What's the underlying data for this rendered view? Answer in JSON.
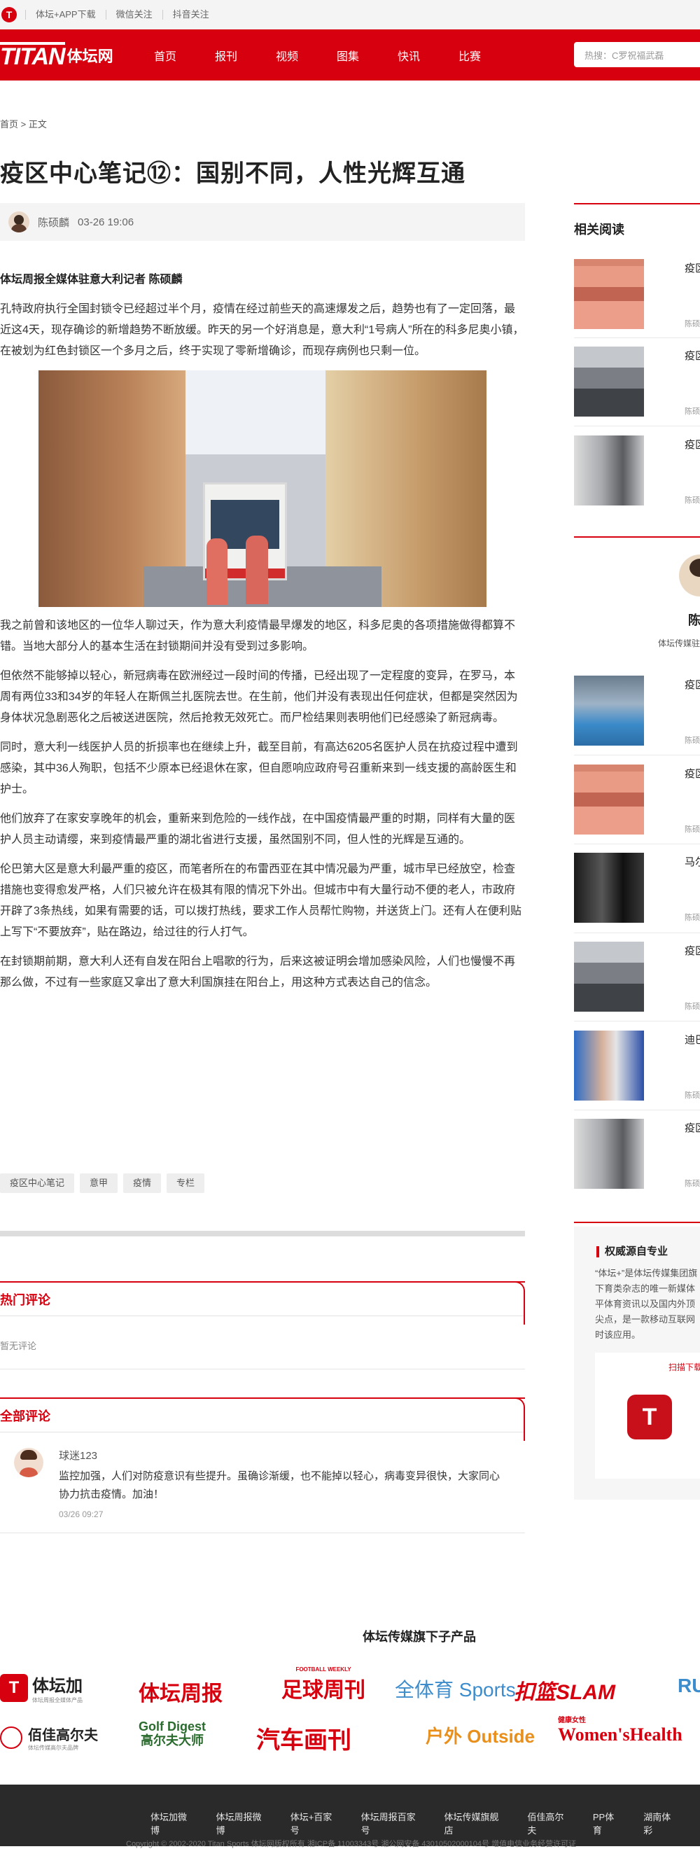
{
  "topbar": {
    "items": [
      "体坛+APP下载",
      "微信关注",
      "抖音关注"
    ]
  },
  "nav": {
    "brand_en": "TITAN",
    "brand_cn": "体坛网",
    "items": [
      "首页",
      "报刊",
      "视频",
      "图集",
      "快讯",
      "比赛"
    ],
    "search_placeholder": "热搜：C罗祝福武磊"
  },
  "breadcrumb": {
    "home": "首页",
    "sep": ">",
    "current": "正文"
  },
  "article": {
    "title": "疫区中心笔记⑫：国别不同，人性光辉互通",
    "author": "陈硕麟",
    "date": "03-26 19:06",
    "lead": "体坛周报全媒体驻意大利记者 陈硕麟",
    "p1": "孔特政府执行全国封锁令已经超过半个月，疫情在经过前些天的高速爆发之后，趋势也有了一定回落，最近这4天，现存确诊的新增趋势不断放缓。昨天的另一个好消息是，意大利“1号病人”所在的科多尼奥小镇，在被划为红色封锁区一个多月之后，终于实现了零新增确诊，而现存病例也只剩一位。",
    "p2": "我之前曾和该地区的一位华人聊过天，作为意大利疫情最早爆发的地区，科多尼奥的各项措施做得都算不错。当地大部分人的基本生活在封锁期间并没有受到过多影响。",
    "p3": "但依然不能够掉以轻心，新冠病毒在欧洲经过一段时间的传播，已经出现了一定程度的变异，在罗马，本周有两位33和34岁的年轻人在斯佩兰扎医院去世。在生前，他们并没有表现出任何症状，但都是突然因为身体状况急剧恶化之后被送进医院，然后抢救无效死亡。而尸检结果则表明他们已经感染了新冠病毒。",
    "p4": "同时，意大利一线医护人员的折损率也在继续上升，截至目前，有高达6205名医护人员在抗疫过程中遭到感染，其中36人殉职，包括不少原本已经退休在家，但自愿响应政府号召重新来到一线支援的高龄医生和护士。",
    "p5": "他们放弃了在家安享晚年的机会，重新来到危险的一线作战，在中国疫情最严重的时期，同样有大量的医护人员主动请缨，来到疫情最严重的湖北省进行支援，虽然国别不同，但人性的光辉是互通的。",
    "p6": "伦巴第大区是意大利最严重的疫区，而笔者所在的布雷西亚在其中情况最为严重，城市早已经放空，检查措施也变得愈发严格，人们只被允许在极其有限的情况下外出。但城市中有大量行动不便的老人，市政府开辟了3条热线，如果有需要的话，可以拨打热线，要求工作人员帮忙购物，并送货上门。还有人在便利贴上写下“不要放弃”，贴在路边，给过往的行人打气。",
    "p7": "在封锁期前期，意大利人还有自发在阳台上唱歌的行为，后来这被证明会增加感染风险，人们也慢慢不再那么做，不过有一些家庭又拿出了意大利国旗挂在阳台上，用这种方式表达自己的信念。"
  },
  "tags": [
    "疫区中心笔记",
    "意甲",
    "疫情",
    "专栏"
  ],
  "comments": {
    "hot_title": "热门评论",
    "hot_empty": "暂无评论",
    "all_title": "全部评论",
    "list": [
      {
        "user": "球迷123",
        "text": "监控加强，人们对防疫意识有些提升。虽确诊渐缓，也不能掉以轻心，病毒变异很快，大家同心协力抗击疫情。加油！",
        "time": "03/26 09:27"
      }
    ]
  },
  "sidebar": {
    "related_title": "相关阅读",
    "related": [
      {
        "title": "疫区亡者",
        "author": "陈硕"
      },
      {
        "title": "疫区犯下",
        "author": "陈硕"
      },
      {
        "title": "疫区大利",
        "author": "陈硕"
      }
    ],
    "profile": {
      "name": "陈",
      "title": "体坛传媒驻"
    },
    "more": [
      {
        "title": "疫区人性",
        "author": "陈硕"
      },
      {
        "title": "疫区亡者",
        "author": "陈硕"
      },
      {
        "title": "马尔错",
        "author": "陈硕"
      },
      {
        "title": "疫区犯下",
        "author": "陈硕"
      },
      {
        "title": "迪巴布尤",
        "author": "陈硕"
      },
      {
        "title": "疫区大利",
        "author": "陈硕"
      }
    ],
    "authority_title": "权威源自专业",
    "authority_desc": "“体坛+”是体坛传媒集团旗下育类杂志的唯一新媒体平体育资讯以及国内外顶尖点，是一款移动互联网时该应用。",
    "scan_text": "扫描下载",
    "app_letter": "T"
  },
  "products": {
    "title": "体坛传媒旗下子产品",
    "row1": [
      "体坛加",
      "体坛周报",
      "足球周刊",
      "全体育 Sports",
      "扣篮SLAM",
      "RU"
    ],
    "row1_sub": "体坛周报全媒体产品",
    "row1_foot_top": "FOOTBALL WEEKLY",
    "row2": [
      "佰佳高尔夫",
      "Golf Digest 高尔夫大师",
      "汽车画刊",
      "户外 Outside",
      "Women'sHealth"
    ],
    "row2_sub": "体坛传媒高尔夫品牌",
    "row2_wh_top": "健康女性"
  },
  "footer": {
    "links": [
      "体坛加微博",
      "体坛周报微博",
      "体坛+百家号",
      "体坛周报百家号",
      "体坛传媒旗舰店",
      "佰佳高尔夫",
      "PP体育",
      "湖南体彩"
    ],
    "copyright": "Copyright © 2002-2020 Titan Sports 体坛网版权所有 湘ICP备 11003343号 湘公网安备 43010502000104号 增值电信业务经营许可证"
  },
  "colors": {
    "brand": "#d7000f",
    "footer_bg": "#2a2a2a"
  }
}
